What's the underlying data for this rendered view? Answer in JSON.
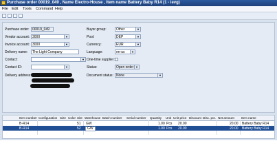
{
  "window": {
    "title": "Purchase order 00019_049 , Name Electro-House , Item name Battery Baby R14 (1 - ievg)"
  },
  "menu": [
    "File",
    "Edit",
    "Tools",
    "Command",
    "Help"
  ],
  "form": {
    "purchase_order": {
      "label": "Purchase order:",
      "value": "00019_049"
    },
    "vendor_account": {
      "label": "Vendor account:",
      "value": "3000"
    },
    "invoice_account": {
      "label": "Invoice account:",
      "value": "3000"
    },
    "delivery_name": {
      "label": "Delivery name:",
      "value": "The Light Company"
    },
    "contact": {
      "label": "Contact:",
      "value": ""
    },
    "contact_id": {
      "label": "Contact ID:",
      "value": ""
    },
    "delivery_address": {
      "label": "Delivery address:"
    },
    "buyer_group": {
      "label": "Buyer group:",
      "value": "Other"
    },
    "pool": {
      "label": "Pool:",
      "value": "DEP"
    },
    "currency": {
      "label": "Currency:",
      "value": "EUR"
    },
    "language": {
      "label": "Language:",
      "value": "en-us"
    },
    "one_time_supplier": {
      "label": "One-time supplier:"
    },
    "status": {
      "label": "Status:",
      "value": "Open order"
    },
    "document_status": {
      "label": "Document status:",
      "value": "None"
    }
  },
  "grid": {
    "columns": [
      "Item number",
      "Configuration",
      "Size",
      "Color",
      "Site",
      "Warehouse",
      "Batch number",
      "Serial number",
      "Quantity",
      "Unit",
      "Unit price",
      "Discount",
      "Disc. pct.",
      "Net amount",
      "Item name"
    ],
    "rows": [
      {
        "item_number": "B-R14",
        "site": "51",
        "warehouse": "GW",
        "quantity": "1.00",
        "unit": "Pcs",
        "unit_price": "20.00",
        "net_amount": "20.00",
        "item_name": "Battery Baby R14"
      },
      {
        "item_number": "B-R14",
        "site": "52",
        "warehouse": "GW",
        "quantity": "1.00",
        "unit": "Pcs",
        "unit_price": "20.00",
        "net_amount": "20.00",
        "item_name": "Battery Baby R14"
      }
    ]
  }
}
